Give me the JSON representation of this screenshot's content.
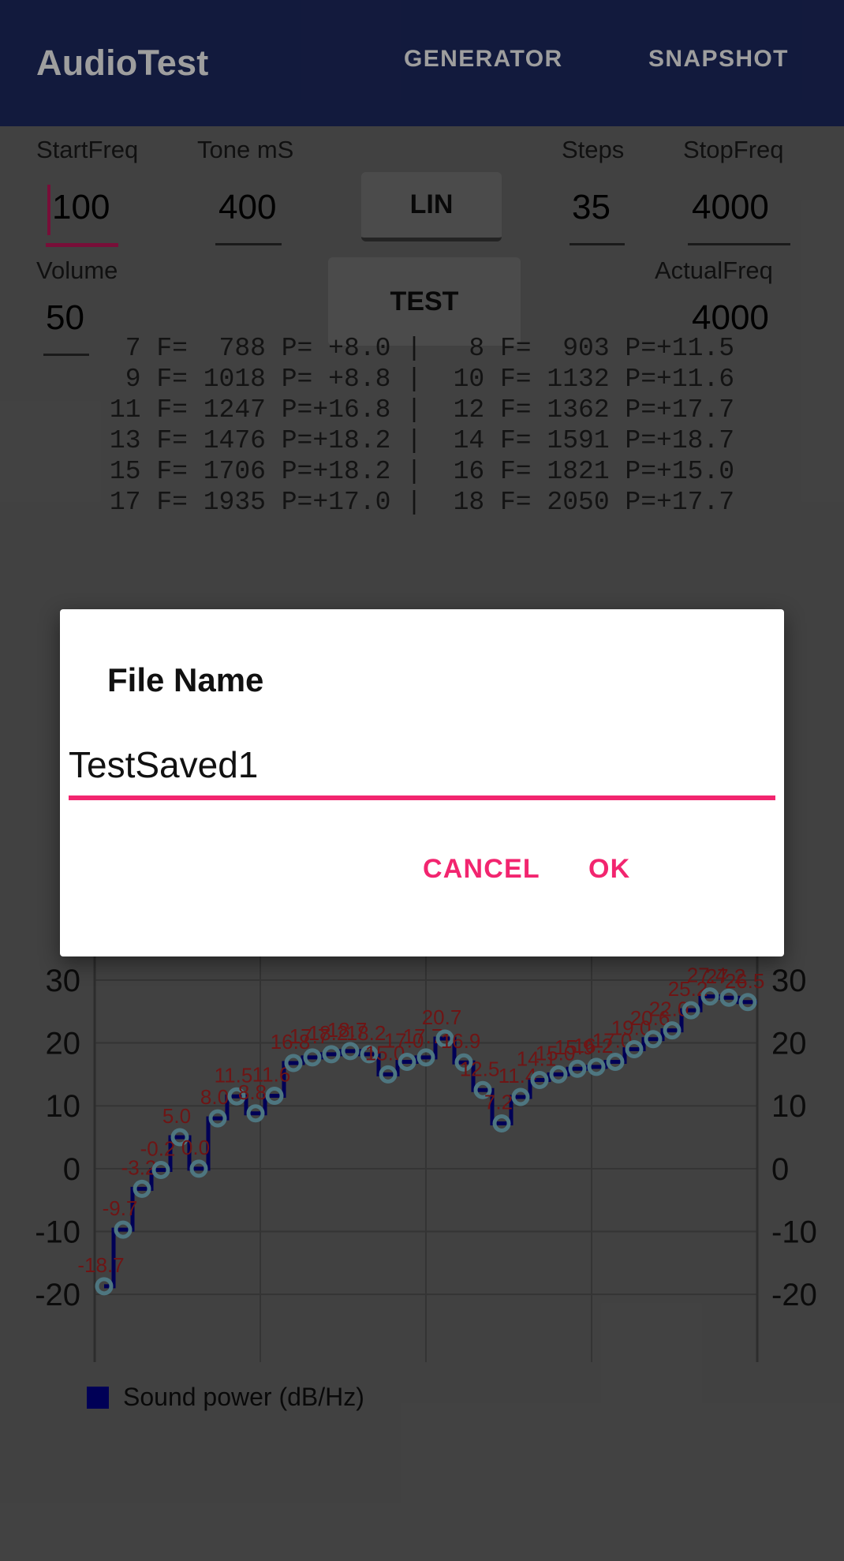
{
  "appbar": {
    "title": "AudioTest",
    "tabs": [
      {
        "name": "generator",
        "label": "GENERATOR"
      },
      {
        "name": "snapshot",
        "label": "SNAPSHOT"
      }
    ],
    "background": "#1e2a63"
  },
  "form": {
    "start_freq": {
      "label": "StartFreq",
      "value": "100",
      "focused": true
    },
    "tone_ms": {
      "label": "Tone mS",
      "value": "400"
    },
    "mode_button": {
      "label": "LIN"
    },
    "steps": {
      "label": "Steps",
      "value": "35"
    },
    "stop_freq": {
      "label": "StopFreq",
      "value": "4000"
    },
    "volume": {
      "label": "Volume",
      "value": "50"
    },
    "test_button": {
      "label": "TEST"
    },
    "actual_freq": {
      "label": "ActualFreq",
      "value": "4000"
    }
  },
  "log": {
    "lines": [
      " 7 F=  788 P= +8.0 |   8 F=  903 P=+11.5",
      " 9 F= 1018 P= +8.8 |  10 F= 1132 P=+11.6",
      "11 F= 1247 P=+16.8 |  12 F= 1362 P=+17.7",
      "13 F= 1476 P=+18.2 |  14 F= 1591 P=+18.7",
      "15 F= 1706 P=+18.2 |  16 F= 1821 P=+15.0",
      "17 F= 1935 P=+17.0 |  18 F= 2050 P=+17.7"
    ]
  },
  "dialog": {
    "title": "File Name",
    "input_value": "TestSaved1",
    "input_placeholder": "",
    "cancel_label": "CANCEL",
    "ok_label": "OK",
    "accent_color": "#f2256f"
  },
  "legend": {
    "label": "Sound power (dB/Hz)",
    "color": "#00008b"
  },
  "chart_data": {
    "type": "line",
    "title": "",
    "xlabel": "",
    "ylabel": "",
    "ylim": [
      -25,
      33
    ],
    "yticks": [
      30,
      20,
      10,
      0,
      -10,
      -20
    ],
    "right_yticks": [
      30,
      20,
      10,
      0,
      -10,
      -20
    ],
    "grid": true,
    "legend_position": "bottom-left",
    "series": [
      {
        "name": "Sound power (dB/Hz)",
        "line_color": "#00008b",
        "marker_color": "#7fbfcf",
        "label_color": "#b22222",
        "values": [
          -18.7,
          -9.7,
          -3.2,
          -0.2,
          5.0,
          -0.0,
          8.0,
          11.5,
          8.8,
          11.6,
          16.8,
          17.7,
          18.2,
          18.7,
          18.2,
          15.0,
          17.0,
          17.7,
          20.7,
          16.9,
          12.5,
          7.2,
          11.4,
          14.1,
          15.0,
          15.9,
          16.2,
          17.0,
          19.0,
          20.6,
          22.0,
          25.2,
          27.4,
          27.2,
          26.5
        ]
      }
    ]
  }
}
